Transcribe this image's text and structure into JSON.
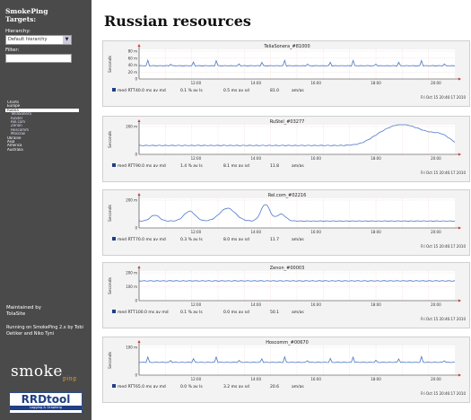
{
  "sidebar": {
    "title_line1": "SmokePing",
    "title_line2": "Targets:",
    "hierarchy_label": "Hierarchy:",
    "hierarchy_value": "Default hierarchy",
    "filter_label": "Filter:",
    "filter_value": "",
    "nav_items": [
      {
        "label": "Charts",
        "level": 1,
        "active": false
      },
      {
        "label": "Europe",
        "level": 1,
        "active": false
      },
      {
        "label": "Russia",
        "level": 1,
        "active": true
      },
      {
        "label": "TeliaSonera",
        "level": 2,
        "active": false
      },
      {
        "label": "RuStel",
        "level": 2,
        "active": false
      },
      {
        "label": "Rel.com",
        "level": 2,
        "active": false
      },
      {
        "label": "Zenon",
        "level": 2,
        "active": false
      },
      {
        "label": "Hoscomm",
        "level": 2,
        "active": false
      },
      {
        "label": "Moscow",
        "level": 2,
        "active": false
      },
      {
        "label": "Ukraine",
        "level": 1,
        "active": false
      },
      {
        "label": "Asia",
        "level": 1,
        "active": false
      },
      {
        "label": "America",
        "level": 1,
        "active": false
      },
      {
        "label": "Australia",
        "level": 1,
        "active": false
      }
    ],
    "maintained_line1": "Maintained by",
    "maintained_line2": "TolaSite",
    "running_text": "Running on SmokePing 2.x by Tobi Oetiker and Niko Tyni",
    "smoke_logo_text": "smoke",
    "smoke_logo_sub": "ping",
    "rrd_logo_text": "RRDtool",
    "rrd_logo_sub": "Logging & Graphing"
  },
  "main": {
    "title": "Russian resources"
  },
  "graphs": [
    {
      "title": "TeliaSonera_#81000",
      "y_axis_label": "Seconds",
      "y_ticks": [
        "80 m",
        "60 m",
        "40 m",
        "20 m",
        "0"
      ],
      "y_max": 90,
      "x_ticks": [
        "12:00",
        "14:00",
        "16:00",
        "18:00",
        "20:00"
      ],
      "profile": "spiky",
      "baseline": 40,
      "bumps": [],
      "legend": {
        "label": "med RTT",
        "avg": "40.0 ms av md",
        "loss": "0.1 % av ls",
        "sd": "0.5 ms av sd",
        "am": "81.0",
        "unit": "am/as"
      },
      "timestamp": "Fri Oct 15 20:46:17 2010"
    },
    {
      "title": "RuStel_#03277",
      "y_axis_label": "Seconds",
      "y_ticks": [
        "200 m",
        "0"
      ],
      "y_max": 300,
      "x_ticks": [
        "12:00",
        "14:00",
        "16:00",
        "18:00",
        "20:00"
      ],
      "profile": "flat",
      "baseline": 90,
      "bumps": [
        [
          0.78,
          0.06,
          130
        ],
        [
          0.84,
          0.05,
          140
        ],
        [
          0.9,
          0.05,
          110
        ],
        [
          0.96,
          0.04,
          90
        ]
      ],
      "legend": {
        "label": "med RTT",
        "avg": "90.0 ms av md",
        "loss": "1.4 % av ls",
        "sd": "8.1 ms av sd",
        "am": "11.8",
        "unit": "am/as"
      },
      "timestamp": "Fri Oct 15 20:46:17 2010"
    },
    {
      "title": "Rel.com_#02216",
      "y_axis_label": "Seconds",
      "y_ticks": [
        "200 m",
        "0"
      ],
      "y_max": 300,
      "x_ticks": [
        "12:00",
        "14:00",
        "16:00",
        "18:00",
        "20:00"
      ],
      "profile": "flat",
      "baseline": 70,
      "bumps": [
        [
          0.05,
          0.02,
          60
        ],
        [
          0.16,
          0.025,
          100
        ],
        [
          0.28,
          0.035,
          130
        ],
        [
          0.4,
          0.02,
          170
        ],
        [
          0.45,
          0.02,
          70
        ]
      ],
      "legend": {
        "label": "med RTT",
        "avg": "70.0 ms av md",
        "loss": "0.3 % av ls",
        "sd": "8.0 ms av sd",
        "am": "11.7",
        "unit": "am/as"
      },
      "timestamp": "Fri Oct 15 20:46:17 2010"
    },
    {
      "title": "Zenon_#00003",
      "y_axis_label": "Seconds",
      "y_ticks": [
        "200 m",
        "100 m",
        "0"
      ],
      "y_max": 300,
      "x_ticks": [
        "12:00",
        "14:00",
        "16:00",
        "18:00",
        "20:00"
      ],
      "profile": "flat",
      "baseline": 200,
      "bumps": [],
      "legend": {
        "label": "med RTT",
        "avg": "100.0 ms av md",
        "loss": "0.1 % av ls",
        "sd": "0.0 ms av sd",
        "am": "50.1",
        "unit": "am/as"
      },
      "timestamp": "Fri Oct 15 20:46:17 2010"
    },
    {
      "title": "Hoscomm_#00670",
      "y_axis_label": "Seconds",
      "y_ticks": [
        "100 m",
        "0"
      ],
      "y_max": 150,
      "x_ticks": [
        "12:00",
        "14:00",
        "16:00",
        "18:00",
        "20:00"
      ],
      "profile": "spiky",
      "baseline": 65,
      "bumps": [],
      "legend": {
        "label": "med RTT",
        "avg": "65.0 ms av md",
        "loss": "0.0 % av ls",
        "sd": "3.2 ms av sd",
        "am": "20.6",
        "unit": "am/as"
      },
      "timestamp": "Fri Oct 15 20:46:17 2010"
    }
  ]
}
